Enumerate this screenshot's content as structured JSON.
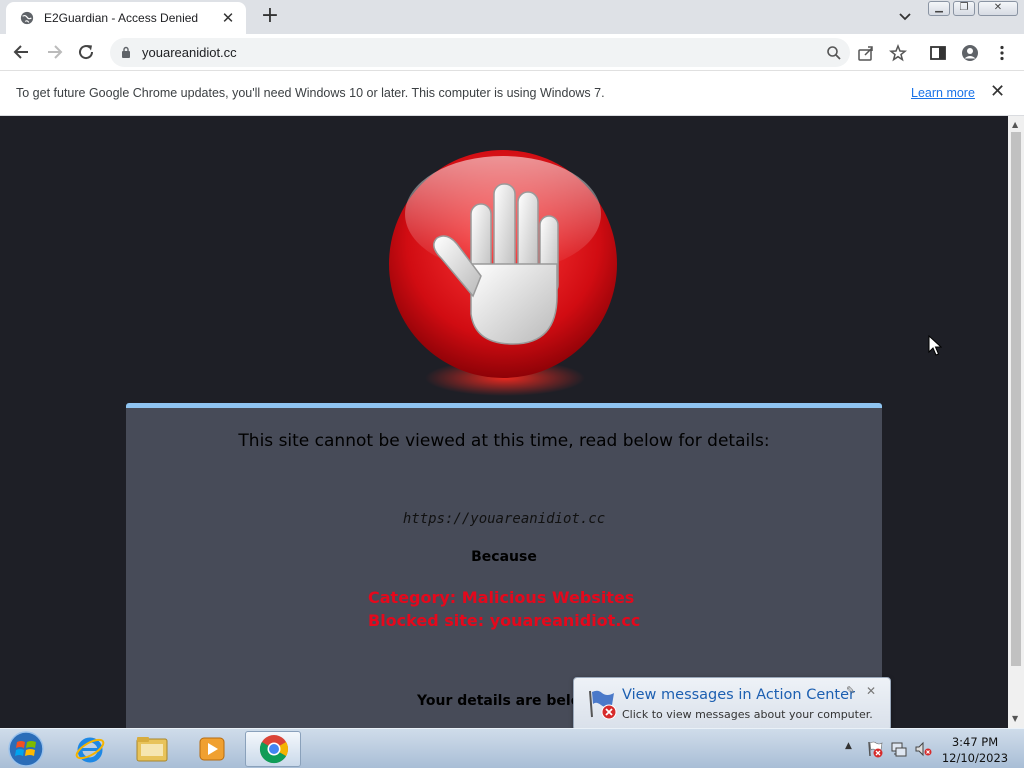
{
  "browser": {
    "tab_title": "E2Guardian - Access Denied",
    "address": "youareanidiot.cc"
  },
  "infobar": {
    "message": "To get future Google Chrome updates, you'll need Windows 10 or later. This computer is using Windows 7.",
    "learn_more": "Learn more"
  },
  "page": {
    "heading": "This site cannot be viewed at this time, read below for details:",
    "blocked_url": "https://youareanidiot.cc",
    "because": "Because",
    "category": "Category: Malicious Websites",
    "blocked_site": "Blocked site: youareanidiot.cc",
    "details": "Your details are below:"
  },
  "notification": {
    "title": "View messages in Action Center",
    "subtitle": "Click to view messages about your computer."
  },
  "taskbar": {
    "time": "3:47 PM",
    "date": "12/10/2023"
  },
  "colors": {
    "page_bg": "#1e1f26",
    "panel_bg": "#474b58",
    "panel_accent": "#8fc4f1",
    "reason_text": "#e5081c"
  }
}
